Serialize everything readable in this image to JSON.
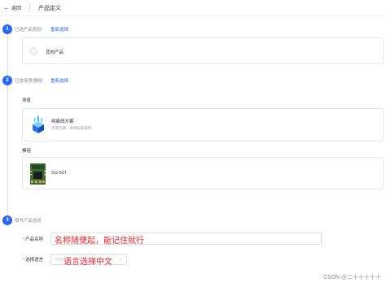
{
  "header": {
    "back_icon": "arrow-left-icon",
    "back_label": "返回",
    "title": "产品定义"
  },
  "steps": [
    {
      "number": "1",
      "title": "已选产品类别",
      "action": "重新选择"
    },
    {
      "number": "2",
      "title": "已选场景/模组",
      "action": "重新选择"
    },
    {
      "number": "3",
      "title": "填写产品信息"
    }
  ],
  "category": {
    "selected": "其他产品"
  },
  "scene": {
    "section": "场景",
    "title": "纯离线方案",
    "desc": "无需连网，离线技能操作"
  },
  "module": {
    "section": "模组",
    "name": "SU-03T"
  },
  "form": {
    "name_label": "产品名称",
    "lang_label": "选择语言",
    "lang_value": "中文",
    "name_annotation": "名称随便起，能记住就行",
    "lang_annotation": "语言选择中文"
  },
  "accent": "#2a66f6",
  "annotation_color": "#e8202a",
  "watermark": "CSDN @二十十十十十"
}
